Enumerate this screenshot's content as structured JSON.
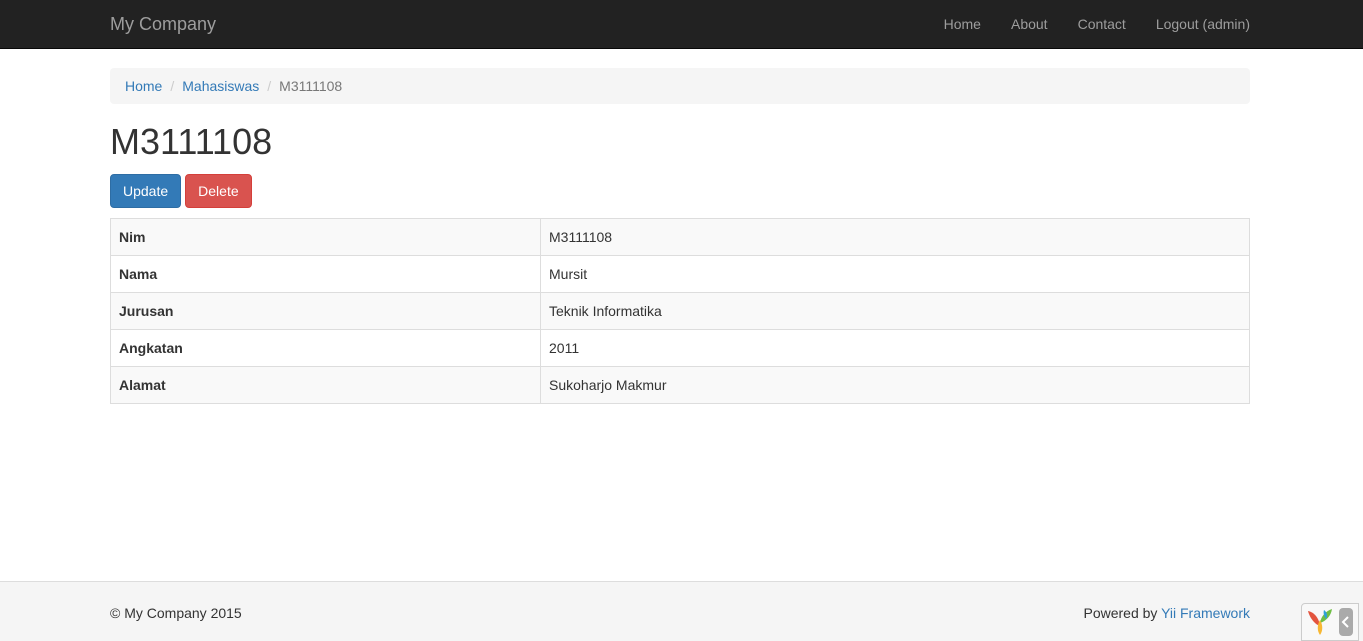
{
  "navbar": {
    "brand": "My Company",
    "items": [
      {
        "label": "Home"
      },
      {
        "label": "About"
      },
      {
        "label": "Contact"
      },
      {
        "label": "Logout (admin)"
      }
    ]
  },
  "breadcrumb": {
    "items": [
      "Home",
      "Mahasiswas"
    ],
    "separator": "/",
    "active": "M3111108"
  },
  "page": {
    "title": "M3111108",
    "update_label": "Update",
    "delete_label": "Delete"
  },
  "detail": [
    {
      "label": "Nim",
      "value": "M3111108"
    },
    {
      "label": "Nama",
      "value": "Mursit"
    },
    {
      "label": "Jurusan",
      "value": "Teknik Informatika"
    },
    {
      "label": "Angkatan",
      "value": "2011"
    },
    {
      "label": "Alamat",
      "value": "Sukoharjo Makmur"
    }
  ],
  "footer": {
    "copyright": "© My Company 2015",
    "powered_prefix": "Powered by",
    "powered_link": "Yii Framework"
  },
  "debug_toolbar": {
    "logo_icon": "yii-logo-icon",
    "toggle_icon": "chevron-left-icon"
  },
  "colors": {
    "navbar_bg": "#222222",
    "primary": "#337ab7",
    "danger": "#d9534f",
    "link": "#337ab7"
  }
}
